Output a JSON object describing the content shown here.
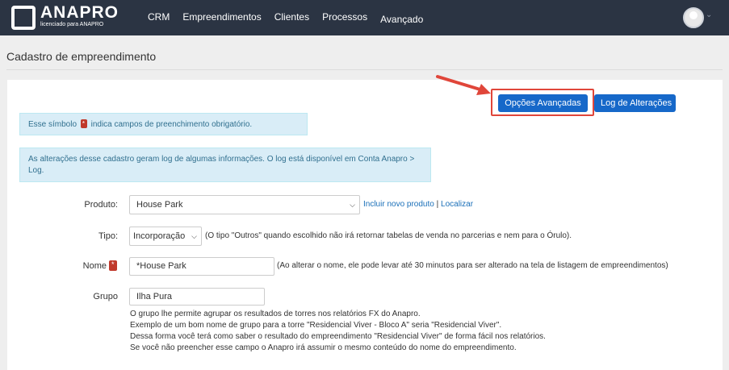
{
  "navbar": {
    "logo_text": "ANAPRO",
    "logo_sub": "licenciado para ANAPRO",
    "links": [
      "CRM",
      "Empreendimentos",
      "Clientes",
      "Processos",
      "Avançado"
    ]
  },
  "page": {
    "title": "Cadastro de empreendimento"
  },
  "buttons": {
    "opcoes": "Opções Avançadas",
    "log": "Log de Alterações"
  },
  "alerts": {
    "required_prefix": "Esse símbolo",
    "required_suffix": "indica campos de preenchimento obrigatório.",
    "log_info": "As alterações desse cadastro geram log de algumas informações. O log está disponível em Conta Anapro > Log."
  },
  "form": {
    "produto": {
      "label": "Produto:",
      "value": "House Park",
      "link_incluir": "Incluir novo produto",
      "separator": "|",
      "link_localizar": "Localizar"
    },
    "tipo": {
      "label": "Tipo:",
      "value": "Incorporação",
      "help": "(O tipo \"Outros\" quando escolhido não irá retornar tabelas de venda no parcerias e nem para o Órulo)."
    },
    "nome": {
      "label": "Nome",
      "value": "*House Park",
      "help": "(Ao alterar o nome, ele pode levar até 30 minutos para ser alterado na tela de listagem de empreendimentos)"
    },
    "grupo": {
      "label": "Grupo",
      "value": "Ilha Pura",
      "help": [
        "O grupo lhe permite agrupar os resultados de torres nos relatórios FX do Anapro.",
        "Exemplo de um bom nome de grupo para a torre \"Residencial Viver - Bloco A\" seria \"Residencial Viver\".",
        "Dessa forma você terá como saber o resultado do empreendimento \"Residencial Viver\" de forma fácil nos relatórios.",
        "Se você não preencher esse campo o Anapro irá assumir o mesmo conteúdo do nome do empreendimento."
      ]
    }
  },
  "colors": {
    "navbar": "#2b3443",
    "primary": "#1668c9",
    "highlight": "#e0463a",
    "required": "#c0392b"
  }
}
